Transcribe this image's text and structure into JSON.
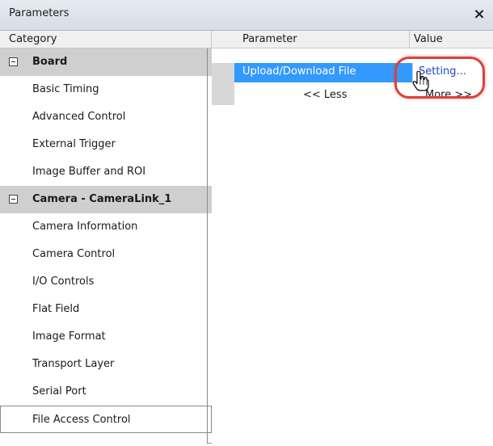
{
  "window": {
    "title": "Parameters",
    "close_glyph": "×"
  },
  "category_panel": {
    "header": "Category",
    "rows": [
      {
        "type": "group",
        "label": "Board"
      },
      {
        "type": "item",
        "label": "Basic Timing"
      },
      {
        "type": "item",
        "label": "Advanced Control"
      },
      {
        "type": "item",
        "label": "External Trigger"
      },
      {
        "type": "item",
        "label": "Image Buffer and ROI"
      },
      {
        "type": "group",
        "label": "Camera - CameraLink_1"
      },
      {
        "type": "item",
        "label": "Camera Information"
      },
      {
        "type": "item",
        "label": "Camera Control"
      },
      {
        "type": "item",
        "label": "I/O Controls"
      },
      {
        "type": "item",
        "label": "Flat Field"
      },
      {
        "type": "item",
        "label": "Image Format"
      },
      {
        "type": "item",
        "label": "Transport Layer"
      },
      {
        "type": "item",
        "label": "Serial Port"
      },
      {
        "type": "item",
        "label": "File Access Control",
        "selected": true
      }
    ]
  },
  "parameter_panel": {
    "header_parameter": "Parameter",
    "header_value": "Value",
    "rows": [
      {
        "parameter": "Upload/Download File",
        "value": "Setting..."
      }
    ],
    "less_label": "<< Less",
    "more_label": "More >>"
  },
  "colors": {
    "selection": "#3399ff",
    "link": "#1d47c7",
    "highlight": "#d9423c",
    "group_bg": "#cfcfcf"
  },
  "icons": {
    "cursor": "hand-pointer-icon",
    "collapse": "minus-box-icon",
    "close": "close-icon"
  }
}
